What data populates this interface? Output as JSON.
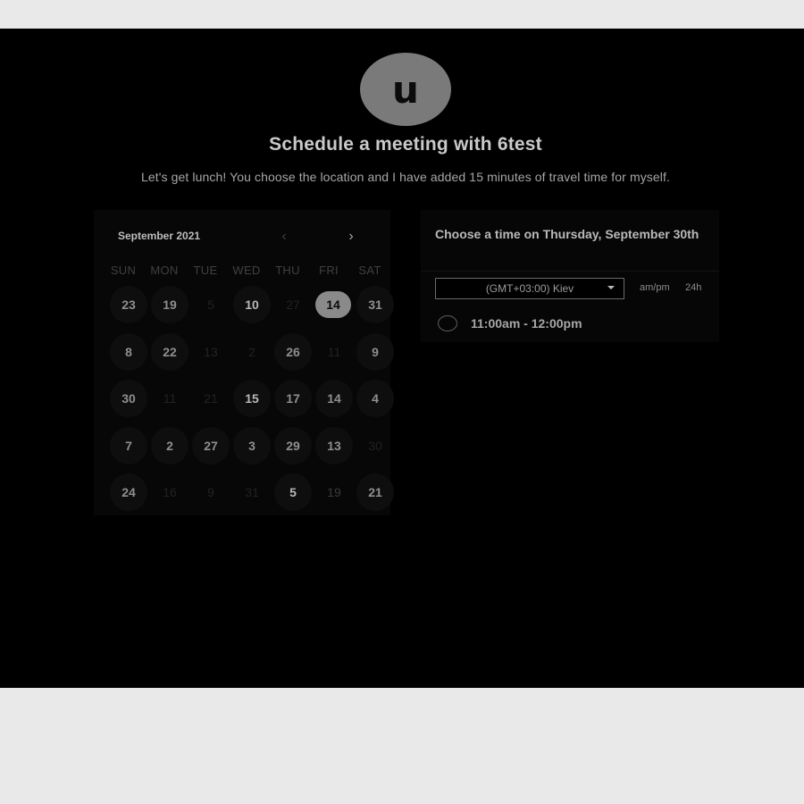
{
  "header": {
    "avatar_letter": "u",
    "title": "Schedule a meeting with 6test",
    "subtitle": "Let's get lunch! You choose the location and I have added 15 minutes of travel time for myself."
  },
  "calendar": {
    "month_label": "September 2021",
    "prev_icon": "chevron-left-icon",
    "next_icon": "chevron-right-icon",
    "prev_glyph": "‹",
    "next_glyph": "›",
    "weekdays": [
      "SUN",
      "MON",
      "TUE",
      "WED",
      "THU",
      "FRI",
      "SAT"
    ],
    "rows": [
      [
        {
          "d": "23",
          "s": "avail"
        },
        {
          "d": "19",
          "s": "avail"
        },
        {
          "d": "5",
          "s": "muted"
        },
        {
          "d": "10",
          "s": "avail hi"
        },
        {
          "d": "27",
          "s": "muted"
        },
        {
          "d": "14",
          "s": "selected"
        },
        {
          "d": "31",
          "s": "avail"
        }
      ],
      [
        {
          "d": "8",
          "s": "avail"
        },
        {
          "d": "22",
          "s": "avail"
        },
        {
          "d": "13",
          "s": "muted"
        },
        {
          "d": "2",
          "s": "muted"
        },
        {
          "d": "26",
          "s": "avail"
        },
        {
          "d": "11",
          "s": "muted"
        },
        {
          "d": "9",
          "s": "avail"
        }
      ],
      [
        {
          "d": "30",
          "s": "avail"
        },
        {
          "d": "11",
          "s": "muted"
        },
        {
          "d": "21",
          "s": "muted"
        },
        {
          "d": "15",
          "s": "avail hi"
        },
        {
          "d": "17",
          "s": "avail"
        },
        {
          "d": "14",
          "s": "avail"
        },
        {
          "d": "4",
          "s": "avail"
        }
      ],
      [
        {
          "d": "7",
          "s": "avail"
        },
        {
          "d": "2",
          "s": "avail"
        },
        {
          "d": "27",
          "s": "avail"
        },
        {
          "d": "3",
          "s": "avail"
        },
        {
          "d": "29",
          "s": "avail"
        },
        {
          "d": "13",
          "s": "avail"
        },
        {
          "d": "30",
          "s": "muted"
        }
      ],
      [
        {
          "d": "24",
          "s": "avail"
        },
        {
          "d": "16",
          "s": "muted"
        },
        {
          "d": "9",
          "s": "muted"
        },
        {
          "d": "31",
          "s": "muted"
        },
        {
          "d": "5",
          "s": "avail hi"
        },
        {
          "d": "19",
          "s": "muted soft"
        },
        {
          "d": "21",
          "s": "avail"
        }
      ]
    ]
  },
  "time_panel": {
    "heading": "Choose a time on Thursday, September 30th",
    "timezone": "(GMT+03:00) Kiev",
    "format_ampm": "am/pm",
    "format_24h": "24h",
    "slots": [
      "11:00am - 12:00pm"
    ]
  },
  "colors": {
    "page_bg": "#e9e9e9",
    "stage_bg": "#000000",
    "avatar_bg": "#7a7a7a",
    "selected_day_bg": "#8a8a8a"
  }
}
